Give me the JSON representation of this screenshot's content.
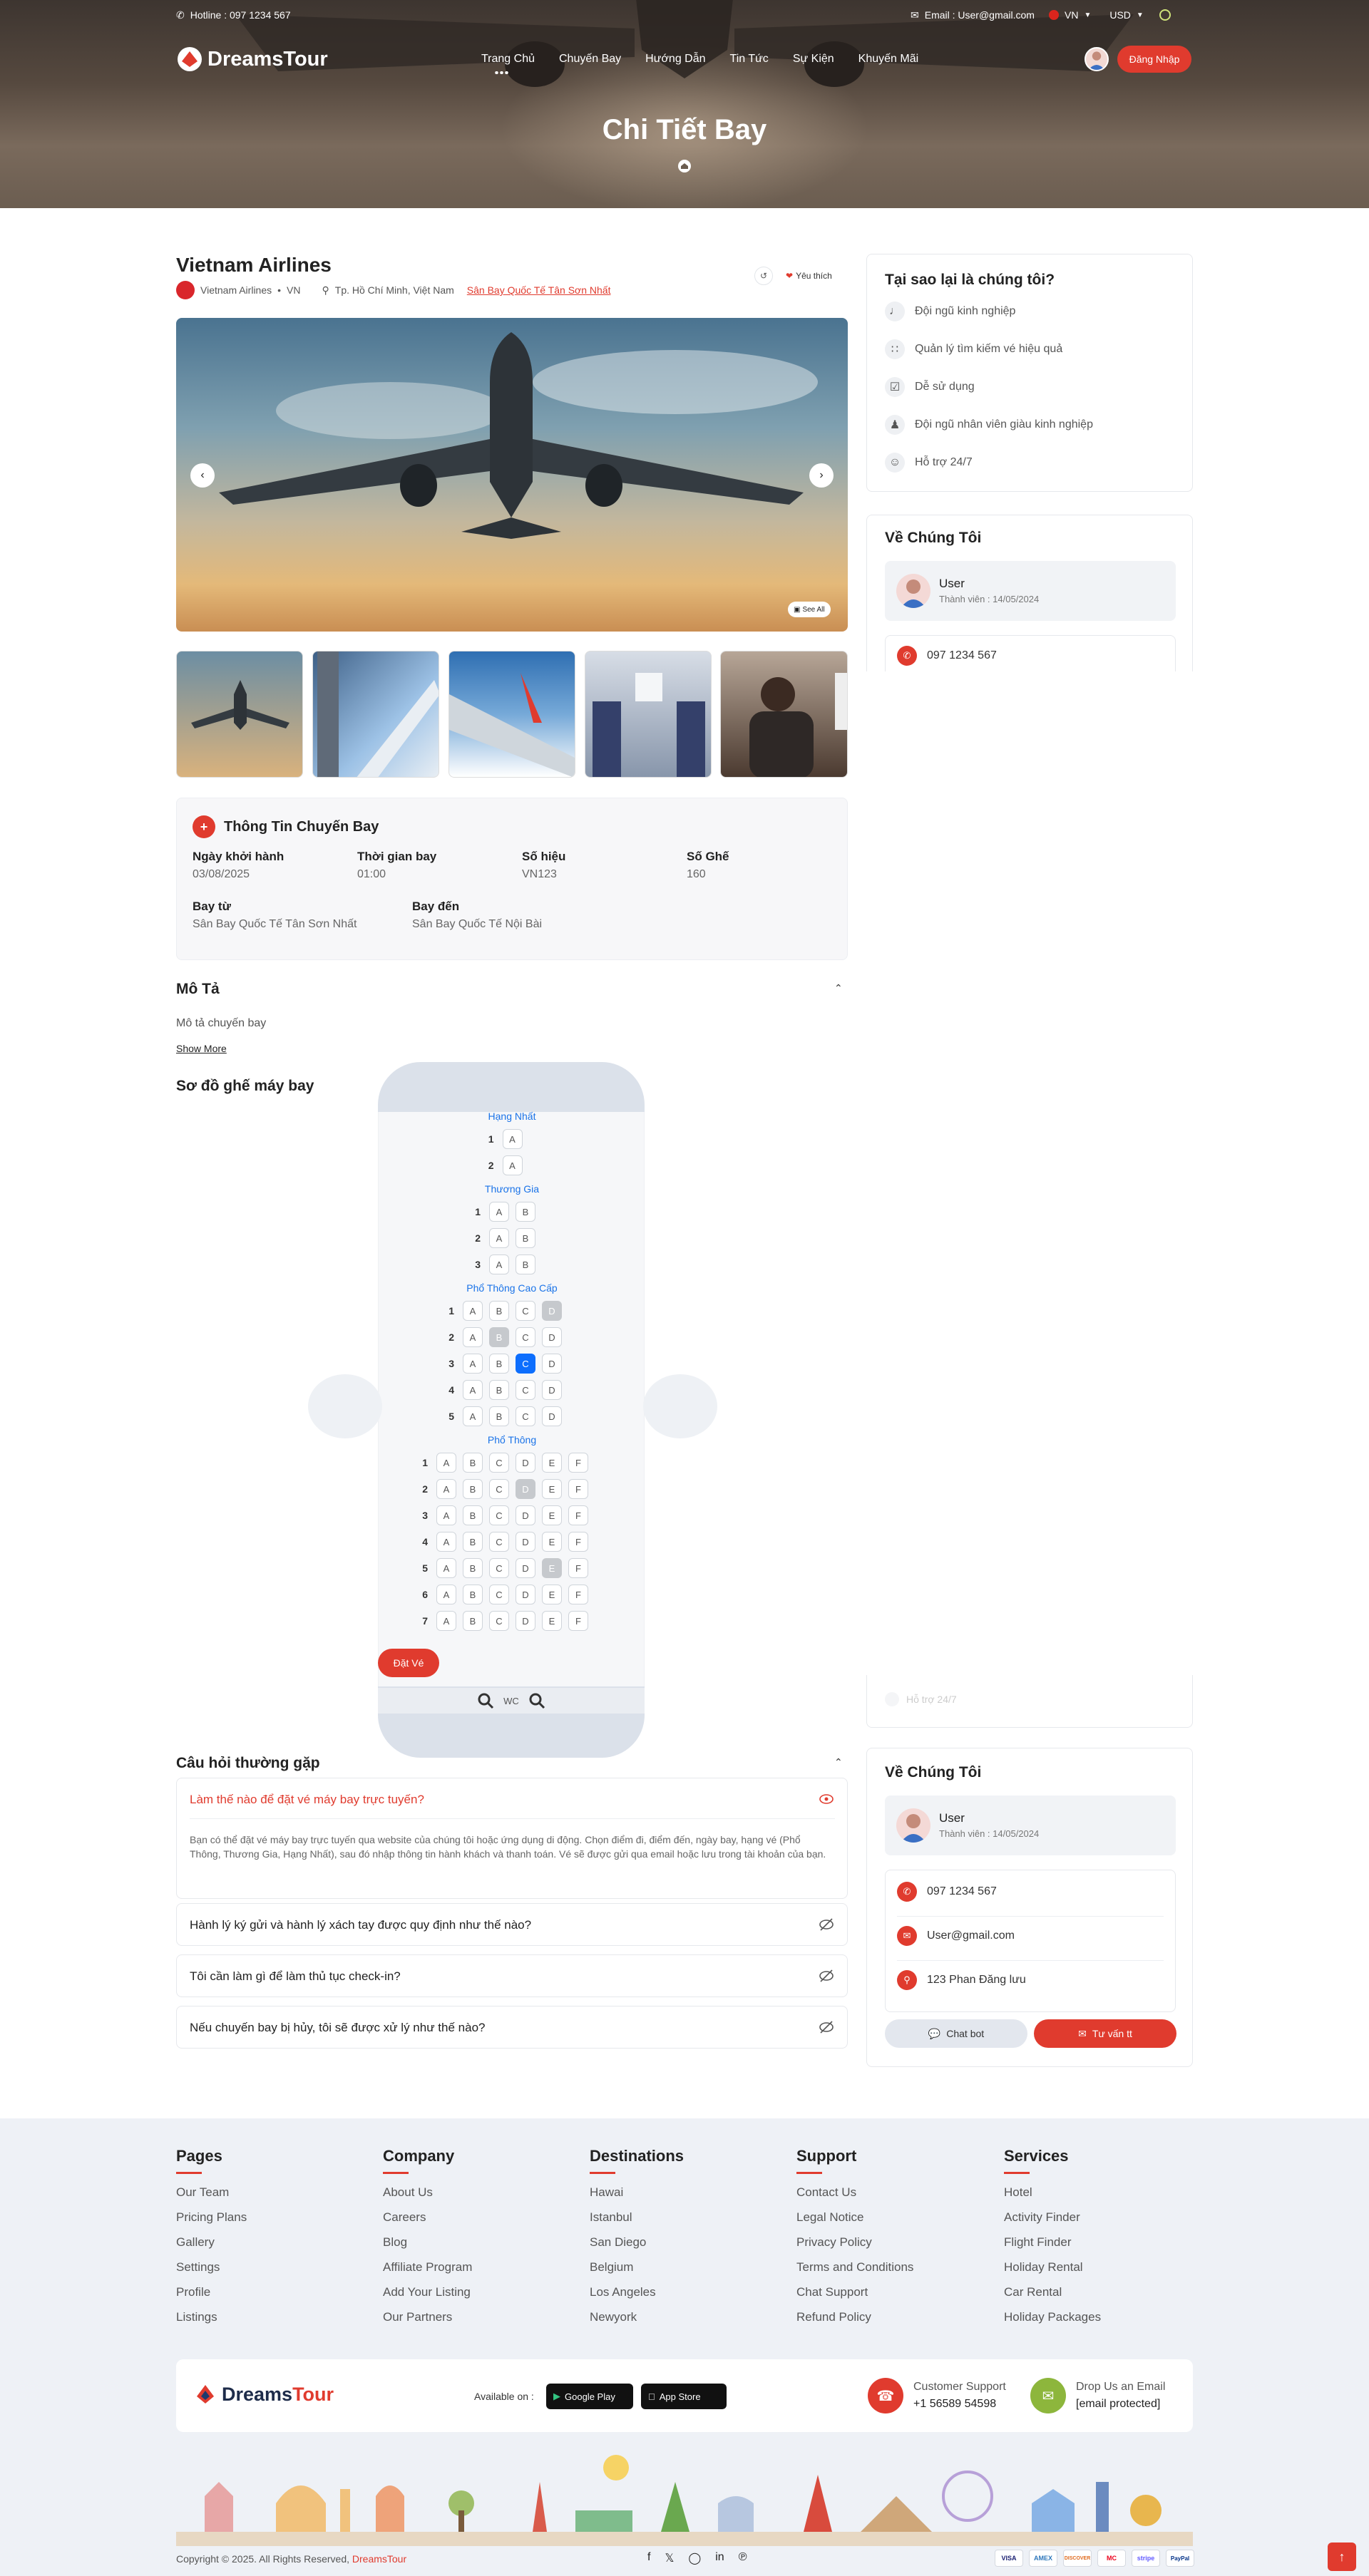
{
  "topbar": {
    "hotline": "Hotline : 097 1234 567",
    "email": "Email : User@gmail.com",
    "language": "VN",
    "currency": "USD"
  },
  "navbar": {
    "logo_text": "DreamsTour",
    "menu": [
      "Trang Chủ",
      "Chuyến Bay",
      "Hướng Dẫn",
      "Tin Tức",
      "Sự Kiện",
      "Khuyến Mãi"
    ],
    "login_label": "Đăng Nhập"
  },
  "hero": {
    "title": "Chi Tiết Bay"
  },
  "flight": {
    "airline": "Vietnam Airlines",
    "airline_small": "Vietnam Airlines",
    "country": "VN",
    "location": "Tp. Hồ Chí Minh, Việt Nam",
    "airport_link": "Sân Bay Quốc Tế Tân Sơn Nhất",
    "favorite_label": "Yêu thích",
    "see_all_label": "See All"
  },
  "flight_info": {
    "title": "Thông Tin Chuyến Bay",
    "fields": [
      {
        "label": "Ngày khởi hành",
        "value": "03/08/2025"
      },
      {
        "label": "Thời gian bay",
        "value": "01:00"
      },
      {
        "label": "Số hiệu",
        "value": "VN123"
      },
      {
        "label": "Số Ghế",
        "value": "160"
      },
      {
        "label": "Bay từ",
        "value": "Sân Bay Quốc Tế Tân Sơn Nhất"
      },
      {
        "label": "Bay đến",
        "value": "Sân Bay Quốc Tế Nội Bài"
      }
    ]
  },
  "description": {
    "title": "Mô Tả",
    "text": "Mô tả chuyến bay",
    "show_more": "Show More"
  },
  "seatmap": {
    "title": "Sơ đồ ghế máy bay",
    "book_label": "Đặt Vé",
    "wc_label": "WC",
    "classes": [
      {
        "name": "Hạng Nhất",
        "letters": [
          "A"
        ],
        "rows": 2,
        "taken": [],
        "selected": []
      },
      {
        "name": "Thương Gia",
        "letters": [
          "A",
          "B"
        ],
        "rows": 3,
        "taken": [],
        "selected": []
      },
      {
        "name": "Phổ Thông Cao Cấp",
        "letters": [
          "A",
          "B",
          "C",
          "D"
        ],
        "rows": 5,
        "taken": [
          "1D",
          "2B"
        ],
        "selected": [
          "3C"
        ]
      },
      {
        "name": "Phổ Thông",
        "letters": [
          "A",
          "B",
          "C",
          "D",
          "E",
          "F"
        ],
        "rows": 7,
        "taken": [
          "2D",
          "5E"
        ],
        "selected": []
      }
    ]
  },
  "faq": {
    "title": "Câu hỏi thường gặp",
    "items": [
      {
        "q": "Làm thế nào để đặt vé máy bay trực tuyến?",
        "a": "Bạn có thể đặt vé máy bay trực tuyến qua website của chúng tôi hoặc ứng dụng di động. Chọn điểm đi, điểm đến, ngày bay, hạng vé (Phổ Thông, Thương Gia, Hạng Nhất), sau đó nhập thông tin hành khách và thanh toán. Vé sẽ được gửi qua email hoặc lưu trong tài khoản của bạn."
      },
      {
        "q": "Hành lý ký gửi và hành lý xách tay được quy định như thế nào?"
      },
      {
        "q": "Tôi cần làm gì để làm thủ tục check-in?"
      },
      {
        "q": "Nếu chuyến bay bị hủy, tôi sẽ được xử lý như thế nào?"
      }
    ]
  },
  "sidebar": {
    "why_title": "Tại sao lại là chúng tôi?",
    "why_items": [
      "Đội ngũ kinh nghiệp",
      "Quản lý tìm kiếm vé hiệu quả",
      "Dễ sử dụng",
      "Đội ngũ nhân viên giàu kinh nghiệp",
      "Hỗ trợ 24/7"
    ],
    "about_title": "Về Chúng Tôi",
    "user_name": "User",
    "member_since": "Thành viên : 14/05/2024",
    "phone": "097 1234 567",
    "email": "User@gmail.com",
    "address": "123 Phan Đăng lưu",
    "chatbot_label": "Chat bot",
    "consult_label": "Tư vấn tt",
    "ghost_text": "Hỗ trợ 24/7"
  },
  "footer": {
    "columns": [
      {
        "title": "Pages",
        "links": [
          "Our Team",
          "Pricing Plans",
          "Gallery",
          "Settings",
          "Profile",
          "Listings"
        ]
      },
      {
        "title": "Company",
        "links": [
          "About Us",
          "Careers",
          "Blog",
          "Affiliate Program",
          "Add Your Listing",
          "Our Partners"
        ]
      },
      {
        "title": "Destinations",
        "links": [
          "Hawai",
          "Istanbul",
          "San Diego",
          "Belgium",
          "Los Angeles",
          "Newyork"
        ]
      },
      {
        "title": "Support",
        "links": [
          "Contact Us",
          "Legal Notice",
          "Privacy Policy",
          "Terms and Conditions",
          "Chat Support",
          "Refund Policy"
        ]
      },
      {
        "title": "Services",
        "links": [
          "Hotel",
          "Activity Finder",
          "Flight Finder",
          "Holiday Rental",
          "Car Rental",
          "Holiday Packages"
        ]
      }
    ],
    "logo_dark": "Dreams",
    "logo_red": "Tour",
    "available_on": "Available on :",
    "google_play": "Google Play",
    "app_store": "App Store",
    "support_label": "Customer Support",
    "support_phone": "+1 56589 54598",
    "email_label": "Drop Us an Email",
    "email_value": "[email protected]",
    "copyright": "Copyright © 2025. All Rights Reserved,",
    "copyright_brand": "DreamsTour",
    "payments": [
      "VISA",
      "AMEX",
      "DISCOVER",
      "MC",
      "stripe",
      "PayPal"
    ]
  },
  "colors": {
    "accent": "#e03b2e",
    "selected_seat": "#0d6efd",
    "link_blue": "#1a73e8"
  }
}
